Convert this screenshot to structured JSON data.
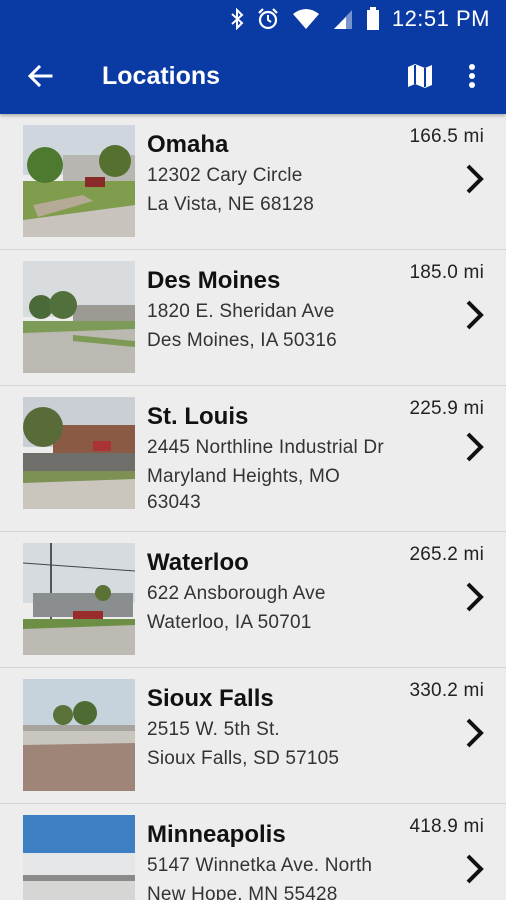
{
  "status": {
    "time": "12:51 PM",
    "icons": [
      "bluetooth-icon",
      "alarm-icon",
      "wifi-icon",
      "signal-icon",
      "battery-icon"
    ]
  },
  "appbar": {
    "title": "Locations",
    "back_icon": "arrow-left-icon",
    "actions": [
      "map-icon",
      "more-vert-icon"
    ]
  },
  "colors": {
    "primary": "#0a3aa3",
    "background": "#ececec"
  },
  "locations": [
    {
      "name": "Omaha",
      "address": "12302 Cary Circle",
      "city": "La Vista, NE 68128",
      "distance": "166.5 mi"
    },
    {
      "name": "Des Moines",
      "address": "1820 E. Sheridan Ave",
      "city": "Des Moines, IA 50316",
      "distance": "185.0 mi"
    },
    {
      "name": "St. Louis",
      "address": "2445 Northline Industrial Dr",
      "city": "Maryland Heights, MO 63043",
      "distance": "225.9 mi"
    },
    {
      "name": "Waterloo",
      "address": "622 Ansborough Ave",
      "city": "Waterloo, IA 50701",
      "distance": "265.2 mi"
    },
    {
      "name": "Sioux Falls",
      "address": "2515 W. 5th St.",
      "city": "Sioux Falls, SD 57105",
      "distance": "330.2 mi"
    },
    {
      "name": "Minneapolis",
      "address": "5147 Winnetka Ave. North",
      "city": "New Hope, MN 55428",
      "distance": "418.9 mi"
    }
  ]
}
